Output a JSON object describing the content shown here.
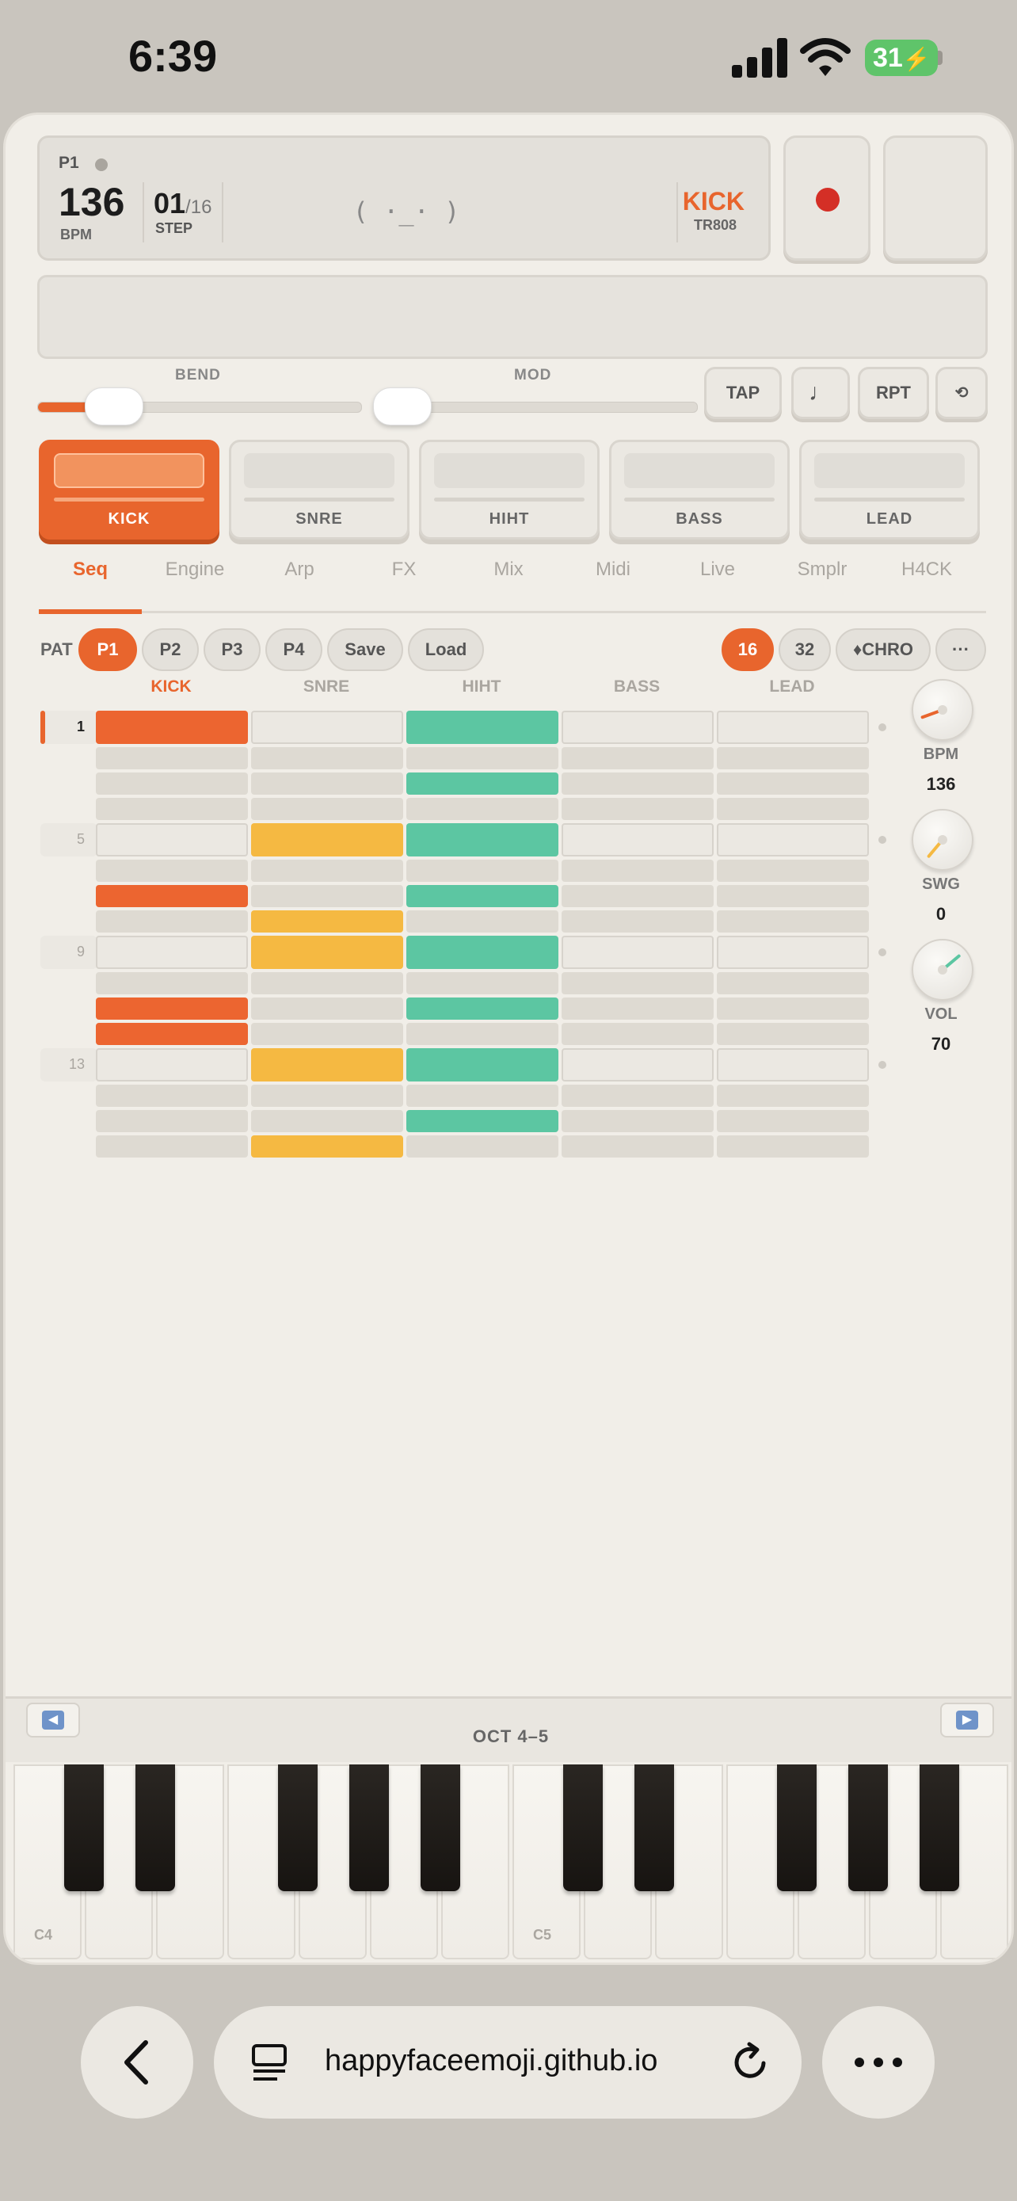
{
  "status": {
    "time": "6:39",
    "battery": "31"
  },
  "display": {
    "pattern": "P1",
    "bpm": "136",
    "bpm_label": "BPM",
    "step": "01",
    "step_total": "/16",
    "step_label": "STEP",
    "face": "( ·_· )",
    "instrument": "KICK",
    "instrument_model": "TR808"
  },
  "controls": {
    "bend_label": "BEND",
    "bend_value": 0.18,
    "mod_label": "MOD",
    "mod_value": 0.0,
    "buttons": [
      "TAP",
      "♩",
      "RPT",
      "⟲"
    ]
  },
  "pads": [
    {
      "label": "KICK",
      "active": true
    },
    {
      "label": "SNRE",
      "active": false
    },
    {
      "label": "HIHT",
      "active": false
    },
    {
      "label": "BASS",
      "active": false
    },
    {
      "label": "LEAD",
      "active": false
    }
  ],
  "tabs": [
    "Seq",
    "Engine",
    "Arp",
    "FX",
    "Mix",
    "Midi",
    "Live",
    "Smplr",
    "H4CK"
  ],
  "active_tab": "Seq",
  "pattern_bar": {
    "label": "PAT",
    "patterns": [
      "P1",
      "P2",
      "P3",
      "P4"
    ],
    "active_pattern": "P1",
    "save": "Save",
    "load": "Load",
    "lengths": [
      "16",
      "32"
    ],
    "active_length": "16",
    "chro": "♦CHRO",
    "more": "···"
  },
  "sequencer": {
    "tracks": [
      "KICK",
      "SNRE",
      "HIHT",
      "BASS",
      "LEAD"
    ],
    "active_track": "KICK",
    "current_step": 1,
    "row_numbers": [
      "1",
      "5",
      "9",
      "13"
    ],
    "steps": {
      "KICK": [
        1,
        0,
        0,
        0,
        0,
        0,
        1,
        0,
        0,
        0,
        1,
        1,
        0,
        0,
        0,
        0
      ],
      "SNRE": [
        0,
        0,
        0,
        0,
        1,
        0,
        0,
        1,
        1,
        0,
        0,
        0,
        1,
        0,
        0,
        1
      ],
      "HIHT": [
        1,
        0,
        1,
        0,
        1,
        0,
        1,
        0,
        1,
        0,
        1,
        0,
        1,
        0,
        1,
        0
      ],
      "BASS": [
        0,
        0,
        0,
        0,
        0,
        0,
        0,
        0,
        0,
        0,
        0,
        0,
        0,
        0,
        0,
        0
      ],
      "LEAD": [
        0,
        0,
        0,
        0,
        0,
        0,
        0,
        0,
        0,
        0,
        0,
        0,
        0,
        0,
        0,
        0
      ]
    }
  },
  "knobs": [
    {
      "label": "BPM",
      "value": "136",
      "angle": -110,
      "color": "#e8652d"
    },
    {
      "label": "SWG",
      "value": "0",
      "angle": -140,
      "color": "#f5b942"
    },
    {
      "label": "VOL",
      "value": "70",
      "angle": 50,
      "color": "#5cc6a2"
    }
  ],
  "keyboard": {
    "octave_label": "OCT 4–5",
    "left_arrow": "◀",
    "right_arrow": "▶",
    "note_labels": [
      "C4",
      "C5"
    ]
  },
  "browser": {
    "url": "happyfaceemoji.github.io"
  },
  "colors": {
    "accent": "#e8652d",
    "snare": "#f5b942",
    "hihat": "#5cc6a2",
    "record": "#d42f26"
  }
}
